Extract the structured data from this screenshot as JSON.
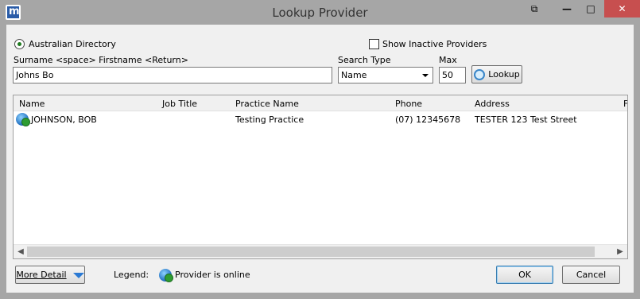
{
  "window": {
    "title": "Lookup Provider",
    "app_icon_text": "m",
    "controls": {
      "extra": "⧉",
      "minimize": "—",
      "maximize": "□",
      "close": "✕"
    }
  },
  "search": {
    "directory_option": "Australian Directory",
    "directory_selected": true,
    "show_inactive_label": "Show Inactive Providers",
    "show_inactive_checked": false,
    "name_label": "Surname <space> Firstname <Return>",
    "name_value": "Johns Bo",
    "search_type_label": "Search Type",
    "search_type_value": "Name",
    "max_label": "Max",
    "max_value": "50",
    "lookup_button": "Lookup"
  },
  "grid": {
    "columns": [
      "Name",
      "Job Title",
      "Practice Name",
      "Phone",
      "Address",
      "F"
    ],
    "rows": [
      {
        "online": true,
        "name": "JOHNSON, BOB",
        "job_title": "",
        "practice": "Testing Practice",
        "phone": "(07) 12345678",
        "address": "TESTER 123 Test Street"
      }
    ],
    "scroll_left": "◀",
    "scroll_right": "▶"
  },
  "footer": {
    "more_detail": "More Detail",
    "legend_label": "Legend:",
    "legend_online": "Provider is online",
    "ok": "OK",
    "cancel": "Cancel"
  }
}
